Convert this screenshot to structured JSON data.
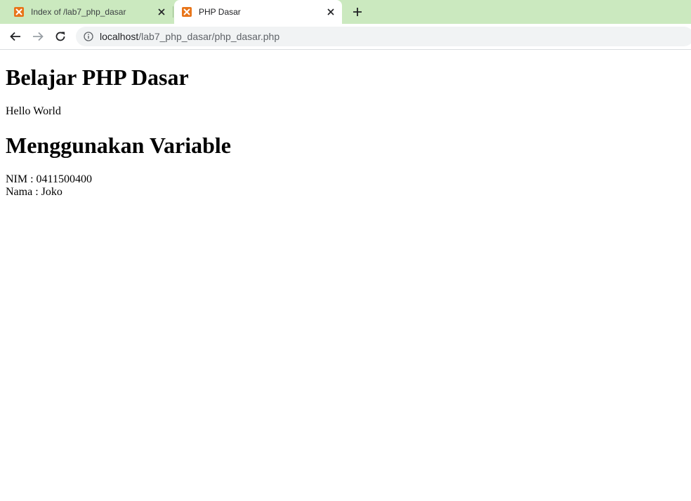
{
  "browser": {
    "tabs": [
      {
        "title": "Index of /lab7_php_dasar",
        "active": false
      },
      {
        "title": "PHP Dasar",
        "active": true
      }
    ],
    "new_tab_icon": "plus-icon",
    "address": {
      "host": "localhost",
      "path": "/lab7_php_dasar/php_dasar.php"
    },
    "colors": {
      "tabstrip_bg": "#cbe9bf",
      "favicon": "#e8751a",
      "omnibox_bg": "#f1f3f4"
    }
  },
  "page": {
    "heading1": "Belajar PHP Dasar",
    "hello": "Hello World",
    "heading2": "Menggunakan Variable",
    "nim_line": "NIM : 0411500400",
    "nama_line": "Nama : Joko"
  }
}
